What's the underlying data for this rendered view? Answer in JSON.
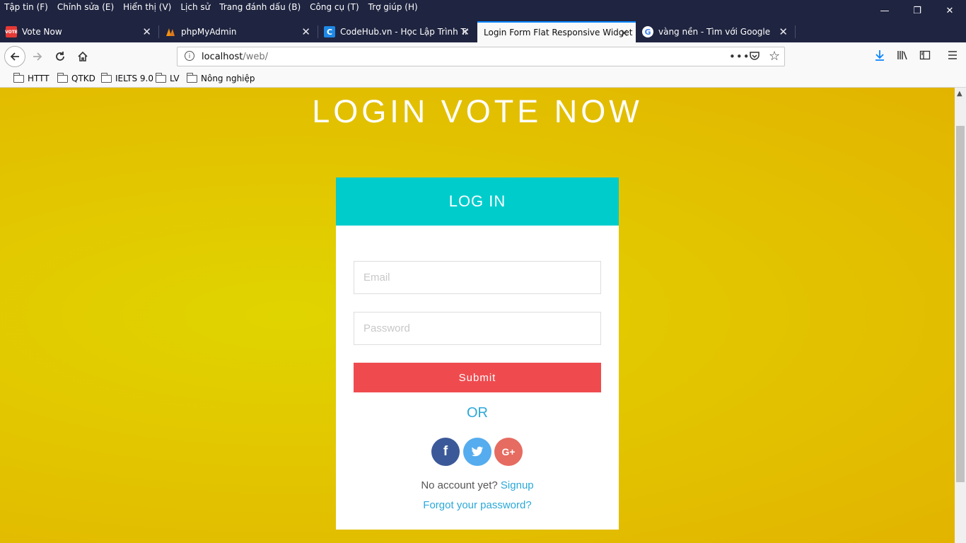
{
  "menu": [
    "Tập tin (F)",
    "Chỉnh sửa (E)",
    "Hiển thị (V)",
    "Lịch sử",
    "Trang đánh dấu (B)",
    "Công cụ (T)",
    "Trợ giúp (H)"
  ],
  "window_controls": {
    "minimize": "—",
    "restore": "❐",
    "close": "✕"
  },
  "tabs": [
    {
      "title": "Vote Now",
      "favicon": "vote-icon",
      "favicon_text": "VOTE"
    },
    {
      "title": "phpMyAdmin",
      "favicon": "phpmyadmin-icon",
      "favicon_text": ""
    },
    {
      "title": "CodeHub.vn - Học Lập Trình Tr",
      "favicon": "codehub-icon",
      "favicon_text": "C"
    },
    {
      "title": "Login Form Flat Responsive Widget",
      "favicon": "",
      "favicon_text": ""
    },
    {
      "title": "vàng nền - Tìm với Google",
      "favicon": "google-icon",
      "favicon_text": "G"
    }
  ],
  "active_tab": 3,
  "address": {
    "host": "localhost",
    "path": "/web/"
  },
  "bookmarks": [
    "HTTT",
    "QTKD",
    "IELTS 9.0",
    "LV",
    "Nông nghiệp"
  ],
  "page": {
    "headline": "LOGIN VOTE NOW",
    "card_title": "LOG IN",
    "email_placeholder": "Email",
    "password_placeholder": "Password",
    "submit_label": "Submit",
    "or_text": "OR",
    "social": [
      {
        "name": "facebook",
        "glyph": "f",
        "color": "#3b5998"
      },
      {
        "name": "twitter",
        "glyph": "t",
        "color": "#55acee"
      },
      {
        "name": "google-plus",
        "glyph": "G+",
        "color": "#dd4b39"
      }
    ],
    "no_account": "No account yet?",
    "signup": "Signup",
    "forgot": "Forgot your password?"
  },
  "colors": {
    "accent": "#00cccc",
    "submit": "#ef4b4f",
    "link": "#2ba8d8",
    "background": "#e2c600"
  }
}
